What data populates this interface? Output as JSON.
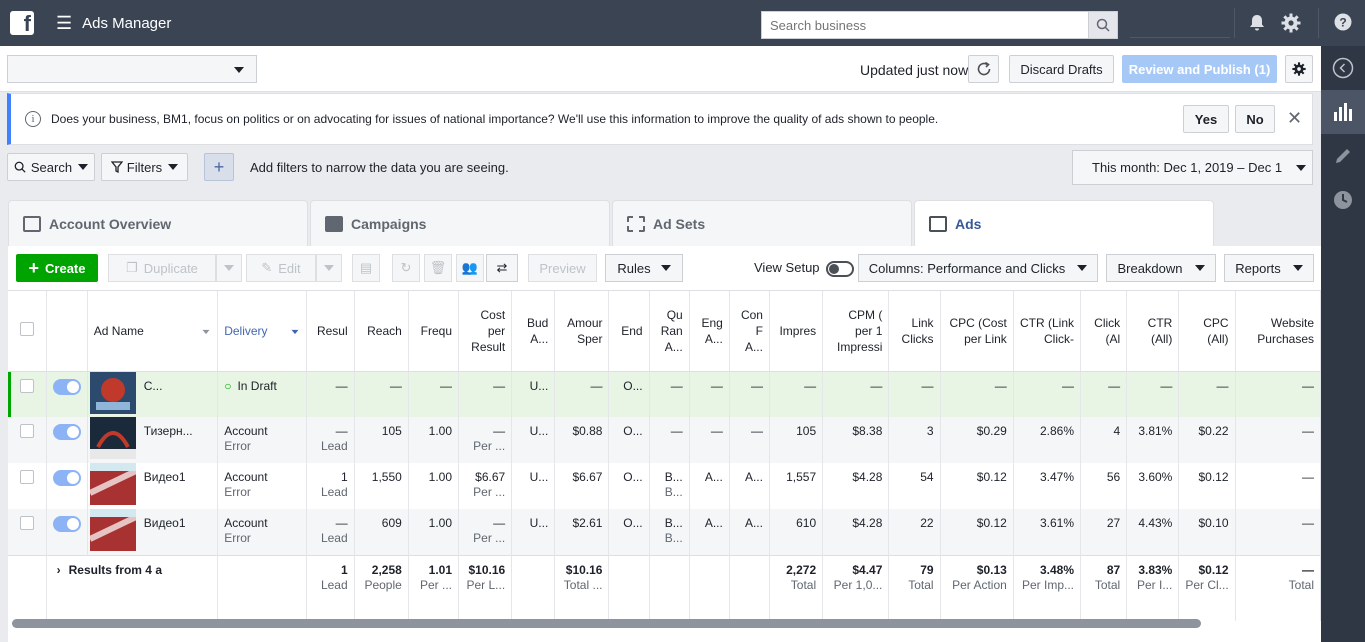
{
  "topbar": {
    "app_title": "Ads Manager",
    "search_placeholder": "Search business",
    "icons": [
      "facebook-logo",
      "hamburger-menu-icon",
      "search-icon",
      "bell-icon",
      "gear-icon",
      "help-icon"
    ]
  },
  "actionbar": {
    "account_select_value": "",
    "updated_text": "Updated just now",
    "discard_label": "Discard Drafts",
    "publish_label": "Review and Publish (1)"
  },
  "notice": {
    "text": "Does your business, BM1, focus on politics or on advocating for issues of national importance? We'll use this information to improve the quality of ads shown to people.",
    "yes_label": "Yes",
    "no_label": "No"
  },
  "filterbar": {
    "search_label": "Search",
    "filters_label": "Filters",
    "hint": "Add filters to narrow the data you are seeing.",
    "date_range": "This month: Dec 1, 2019 – Dec 1"
  },
  "tabs": [
    {
      "label": "Account Overview"
    },
    {
      "label": "Campaigns"
    },
    {
      "label": "Ad Sets"
    },
    {
      "label": "Ads"
    }
  ],
  "toolbar": {
    "create": "Create",
    "duplicate": "Duplicate",
    "edit": "Edit",
    "preview": "Preview",
    "rules": "Rules",
    "view_setup": "View Setup",
    "columns": "Columns: Performance and Clicks",
    "breakdown": "Breakdown",
    "reports": "Reports"
  },
  "table": {
    "headers": [
      "Ad Name",
      "Delivery",
      "Resul",
      "Reach",
      "Frequ",
      "Cost per Result",
      "Bud A...",
      "Amour Sper",
      "End",
      "Qu Ran A...",
      "Eng A...",
      "Con F A...",
      "Impres",
      "CPM ( per 1 Impressi",
      "Link Clicks",
      "CPC (Cost per Link",
      "CTR (Link Click-",
      "Click (Al",
      "CTR (All)",
      "CPC (All)",
      "Website Purchases"
    ],
    "rows": [
      {
        "name": "C...",
        "delivery": "In Draft",
        "delivery_sub": "",
        "result": "—",
        "result_sub": "",
        "reach": "—",
        "freq": "—",
        "cpr": "—",
        "cpr_sub": "",
        "budget": "U...",
        "spent": "—",
        "end": "O...",
        "quality": "—",
        "quality_sub": "",
        "eng": "—",
        "conv": "—",
        "impr": "—",
        "cpm": "—",
        "link_clicks": "—",
        "cpc_link": "—",
        "ctr_link": "—",
        "clicks_all": "—",
        "ctr_all": "—",
        "cpc_all": "—",
        "purchases": "—"
      },
      {
        "name": "Тизерн...",
        "delivery": "Account",
        "delivery_sub": "Error",
        "result": "—",
        "result_sub": "Lead",
        "reach": "105",
        "freq": "1.00",
        "cpr": "—",
        "cpr_sub": "Per ...",
        "budget": "U...",
        "spent": "$0.88",
        "end": "O...",
        "quality": "—",
        "quality_sub": "",
        "eng": "—",
        "conv": "—",
        "impr": "105",
        "cpm": "$8.38",
        "link_clicks": "3",
        "cpc_link": "$0.29",
        "ctr_link": "2.86%",
        "clicks_all": "4",
        "ctr_all": "3.81%",
        "cpc_all": "$0.22",
        "purchases": "—"
      },
      {
        "name": "Видео1",
        "delivery": "Account",
        "delivery_sub": "Error",
        "result": "1",
        "result_sub": "Lead",
        "reach": "1,550",
        "freq": "1.00",
        "cpr": "$6.67",
        "cpr_sub": "Per ...",
        "budget": "U...",
        "spent": "$6.67",
        "end": "O...",
        "quality": "B...",
        "quality_sub": "B...",
        "eng": "A...",
        "conv": "A...",
        "impr": "1,557",
        "cpm": "$4.28",
        "link_clicks": "54",
        "cpc_link": "$0.12",
        "ctr_link": "3.47%",
        "clicks_all": "56",
        "ctr_all": "3.60%",
        "cpc_all": "$0.12",
        "purchases": "—"
      },
      {
        "name": "Видео1",
        "delivery": "Account",
        "delivery_sub": "Error",
        "result": "—",
        "result_sub": "Lead",
        "reach": "609",
        "freq": "1.00",
        "cpr": "—",
        "cpr_sub": "Per ...",
        "budget": "U...",
        "spent": "$2.61",
        "end": "O...",
        "quality": "B...",
        "quality_sub": "B...",
        "eng": "A...",
        "conv": "A...",
        "impr": "610",
        "cpm": "$4.28",
        "link_clicks": "22",
        "cpc_link": "$0.12",
        "ctr_link": "3.61%",
        "clicks_all": "27",
        "ctr_all": "4.43%",
        "cpc_all": "$0.10",
        "purchases": "—"
      }
    ],
    "total": {
      "label": "Results from 4 a",
      "result": "1",
      "result_sub": "Lead",
      "reach": "2,258",
      "reach_sub": "People",
      "freq": "1.01",
      "freq_sub": "Per ...",
      "cpr": "$10.16",
      "cpr_sub": "Per L...",
      "spent": "$10.16",
      "spent_sub": "Total ...",
      "impr": "2,272",
      "impr_sub": "Total",
      "cpm": "$4.47",
      "cpm_sub": "Per 1,0...",
      "link_clicks": "79",
      "link_clicks_sub": "Total",
      "cpc_link": "$0.13",
      "cpc_link_sub": "Per Action",
      "ctr_link": "3.48%",
      "ctr_link_sub": "Per Imp...",
      "clicks_all": "87",
      "clicks_all_sub": "Total",
      "ctr_all": "3.83%",
      "ctr_all_sub": "Per I...",
      "cpc_all": "$0.12",
      "cpc_all_sub": "Per Cl...",
      "purchases": "—",
      "purchases_sub": "Total"
    }
  },
  "colors": {
    "topbar": "#3b4453",
    "create": "#00a400",
    "draft_row": "#e8f4e4",
    "publish_disabled": "#a6c8f6"
  }
}
